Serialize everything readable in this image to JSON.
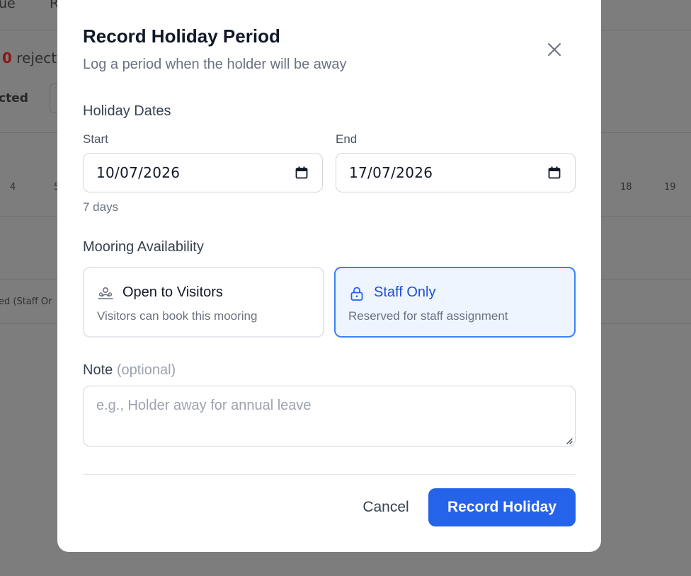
{
  "background": {
    "tabs": [
      "ue",
      "R"
    ],
    "count_number": "0",
    "count_label": "reject",
    "selected_label": "cted",
    "calendar_days": [
      "4",
      "5",
      "18",
      "19"
    ],
    "staff_row_label": "ed (Staff Or"
  },
  "modal": {
    "title": "Record Holiday Period",
    "subtitle": "Log a period when the holder will be away",
    "dates": {
      "section_label": "Holiday Dates",
      "start_label": "Start",
      "start_value": "10/07/2026",
      "end_label": "End",
      "end_value": "17/07/2026",
      "duration": "7 days"
    },
    "availability": {
      "section_label": "Mooring Availability",
      "options": [
        {
          "title": "Open to Visitors",
          "description": "Visitors can book this mooring",
          "selected": false
        },
        {
          "title": "Staff Only",
          "description": "Reserved for staff assignment",
          "selected": true
        }
      ]
    },
    "note": {
      "label": "Note",
      "optional_label": "(optional)",
      "value": "",
      "placeholder": "e.g., Holder away for annual leave"
    },
    "actions": {
      "cancel_label": "Cancel",
      "submit_label": "Record Holiday"
    }
  },
  "colors": {
    "primary": "#2563eb",
    "selected_border": "#3b82f6",
    "selected_bg": "#eef5ff",
    "overlay": "#7d7d7d"
  },
  "icons": {
    "close": "close-icon",
    "calendar": "calendar-icon",
    "visitors": "users-icon",
    "staff": "lock-icon"
  }
}
